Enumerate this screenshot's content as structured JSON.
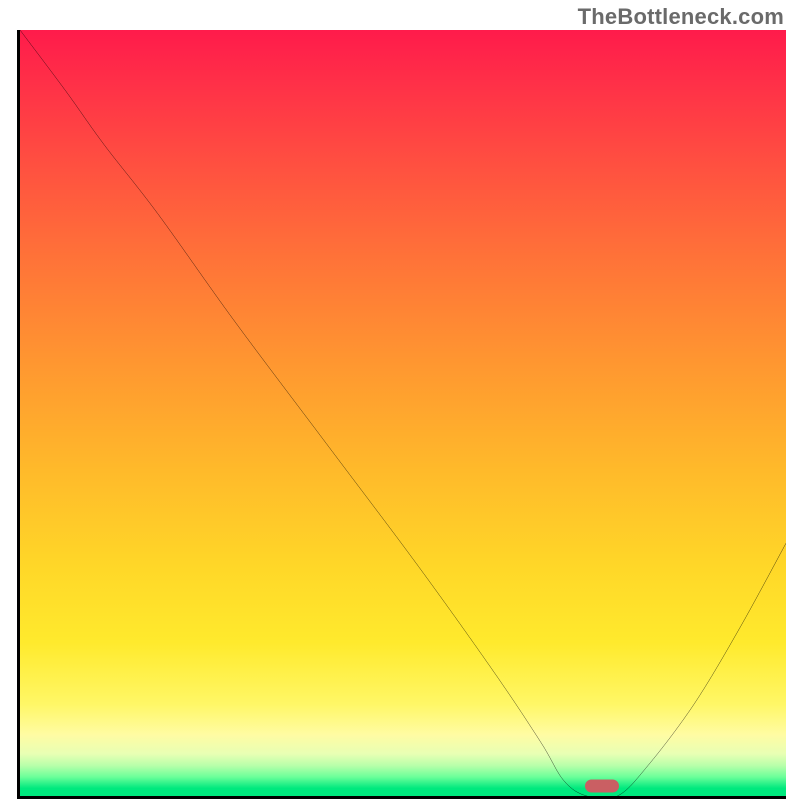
{
  "watermark": "TheBottleneck.com",
  "colors": {
    "frame": "#000000",
    "marker": "#ca5f63",
    "curve": "#000000"
  },
  "chart_data": {
    "type": "line",
    "title": "",
    "xlabel": "",
    "ylabel": "",
    "xlim": [
      0,
      100
    ],
    "ylim": [
      0,
      100
    ],
    "series": [
      {
        "name": "bottleneck-curve",
        "x": [
          0,
          6,
          11,
          18,
          28,
          40,
          52,
          62,
          68,
          71,
          74,
          78,
          82,
          88,
          94,
          100
        ],
        "y": [
          100,
          92,
          85,
          76,
          62,
          46,
          30,
          16,
          7,
          2,
          0,
          0,
          4,
          12,
          22,
          33
        ]
      }
    ],
    "marker": {
      "x": 76,
      "y": 1.3,
      "shape": "pill"
    },
    "grid": false,
    "legend": false,
    "background": "heat-gradient"
  }
}
